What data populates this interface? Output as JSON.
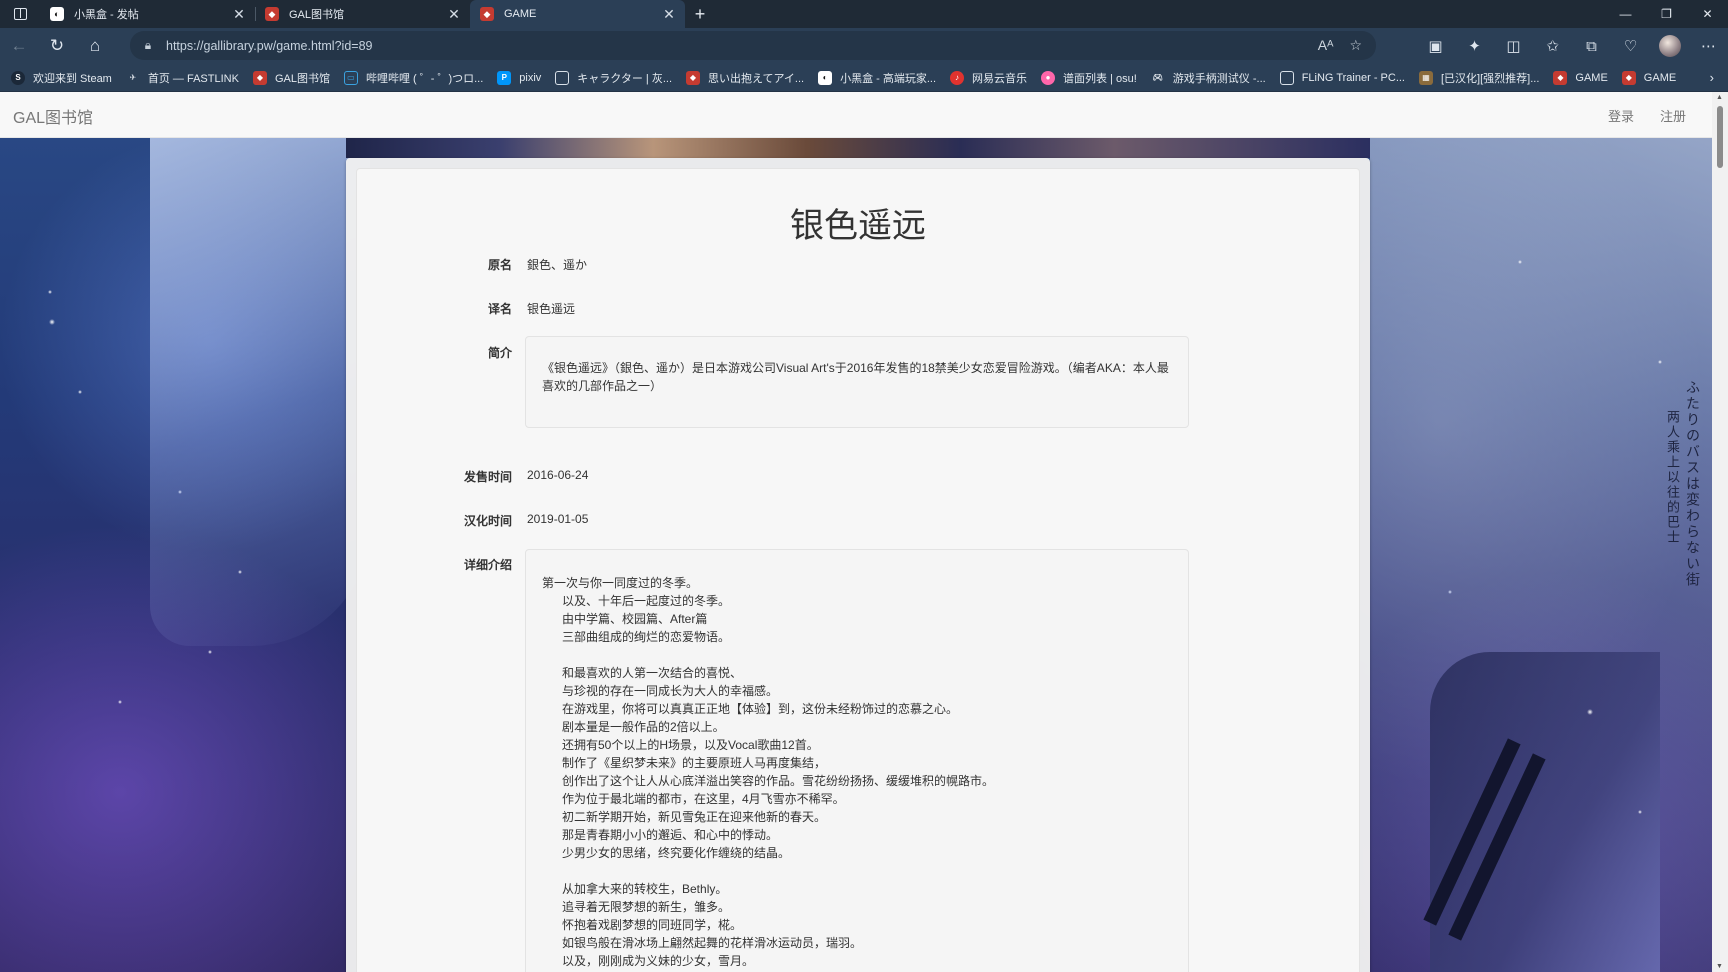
{
  "browser": {
    "tabs": [
      {
        "title": "小黑盒 - 发帖",
        "favicon": "xiaoheihe-icon"
      },
      {
        "title": "GAL图书馆",
        "favicon": "gallibrary-icon"
      },
      {
        "title": "GAME",
        "favicon": "gallibrary-icon",
        "active": true
      }
    ],
    "url": "https://gallibrary.pw/game.html?id=89",
    "bookmarks": [
      "欢迎来到 Steam",
      "首页 — FASTLINK",
      "GAL图书馆",
      "哔哩哔哩 ( ゜- ゜)つロ...",
      "pixiv",
      "キャラクター | 灰...",
      "思い出抱えてアイ...",
      "小黑盒 - 高端玩家...",
      "网易云音乐",
      "谱面列表 | osu!",
      "游戏手柄测试仪 -...",
      "FLiNG Trainer - PC...",
      "[已汉化][强烈推荐]...",
      "GAME",
      "GAME"
    ]
  },
  "site": {
    "brand": "GAL图书馆",
    "nav": {
      "login": "登录",
      "register": "注册"
    }
  },
  "game": {
    "title": "银色遥远",
    "labels": {
      "original_name": "原名",
      "translated_name": "译名",
      "summary": "简介",
      "release_date": "发售时间",
      "localization_date": "汉化时间",
      "details": "详细介绍"
    },
    "original_name": "銀色、遥か",
    "translated_name": "银色遥远",
    "summary": "《银色遥远》（銀色、遥か）是日本游戏公司Visual Art's于2016年发售的18禁美少女恋爱冒险游戏。（编者AKA：本人最喜欢的几部作品之一）",
    "release_date": "2016-06-24",
    "localization_date": "2019-01-05",
    "details": [
      "第一次与你一同度过的冬季。",
      "      以及、十年后一起度过的冬季。",
      "      由中学篇、校园篇、After篇",
      "      三部曲组成的绚烂的恋爱物语。",
      "",
      "      和最喜欢的人第一次结合的喜悦、",
      "      与珍视的存在一同成长为大人的幸福感。",
      "      在游戏里，你将可以真真正正地【体验】到，这份未经粉饰过的恋慕之心。",
      "      剧本量是一般作品的2倍以上。",
      "      还拥有50个以上的H场景，以及Vocal歌曲12首。",
      "      制作了《星织梦未来》的主要原班人马再度集结，",
      "      创作出了这个让人从心底洋溢出笑容的作品。雪花纷纷扬扬、缓缓堆积的幌路市。",
      "      作为位于最北端的都市，在这里，4月飞雪亦不稀罕。",
      "      初二新学期开始，新见雪兔正在迎来他新的春天。",
      "      那是青春期小小的邂逅、和心中的悸动。",
      "      少男少女的思绪，终究要化作缠绕的结晶。",
      "",
      "      从加拿大来的转校生，Bethly。",
      "      追寻着无限梦想的新生，雏多。",
      "      怀抱着戏剧梦想的同班同学，椛。",
      "      如银鸟般在滑冰场上翩然起舞的花样滑冰运动员，瑞羽。",
      "      以及，刚刚成为义妹的少女，雪月。"
    ]
  },
  "wallpaper_text": {
    "line1": "ふたりのバスは変わらない街",
    "line2": "两人乘上以往的巴士"
  }
}
